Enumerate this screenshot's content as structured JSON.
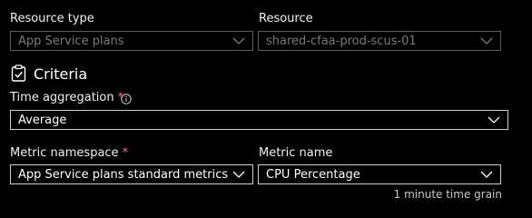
{
  "resource_type": {
    "label": "Resource type",
    "value": "App Service plans"
  },
  "resource": {
    "label": "Resource",
    "value": "shared-cfaa-prod-scus-01"
  },
  "criteria": {
    "title": "Criteria"
  },
  "time_aggregation": {
    "label": "Time aggregation",
    "required_mark": "*",
    "value": "Average"
  },
  "metric_namespace": {
    "label": "Metric namespace",
    "required_mark": "*",
    "value": "App Service plans standard metrics"
  },
  "metric_name": {
    "label": "Metric name",
    "value": "CPU Percentage",
    "hint": "1 minute time grain"
  },
  "colors": {
    "background": "#000000",
    "required": "#f1707b",
    "border_enabled": "#cfcfcf",
    "border_disabled": "#5c5c5c"
  }
}
